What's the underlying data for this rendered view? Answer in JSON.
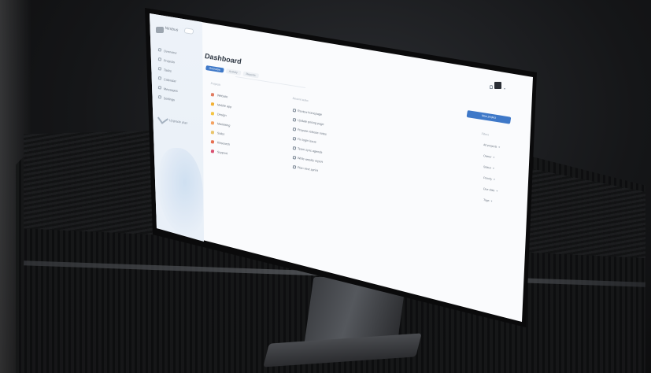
{
  "app": {
    "logo_text": "Nimbus",
    "page_title": "Dashboard",
    "tabs": [
      {
        "label": "Overview"
      },
      {
        "label": "Activity"
      },
      {
        "label": "Reports"
      }
    ],
    "search_placeholder": ""
  },
  "sidebar": {
    "items": [
      {
        "label": "Overview"
      },
      {
        "label": "Projects"
      },
      {
        "label": "Tasks"
      },
      {
        "label": "Calendar"
      },
      {
        "label": "Messages"
      },
      {
        "label": "Settings"
      }
    ],
    "promo_text": "Upgrade plan"
  },
  "main": {
    "left_header": "Projects",
    "left_rows": [
      {
        "label": "Website",
        "color": "#e07a5f"
      },
      {
        "label": "Mobile app",
        "color": "#f2b134"
      },
      {
        "label": "Design",
        "color": "#f4c542"
      },
      {
        "label": "Marketing",
        "color": "#f4a261"
      },
      {
        "label": "Sales",
        "color": "#e9c46a"
      },
      {
        "label": "Research",
        "color": "#e76f51"
      },
      {
        "label": "Support",
        "color": "#d94f70"
      }
    ],
    "mid_header": "Recent tasks",
    "mid_rows": [
      {
        "label": "Review homepage"
      },
      {
        "label": "Update pricing page"
      },
      {
        "label": "Prepare release notes"
      },
      {
        "label": "Fix login issue"
      },
      {
        "label": "Team sync agenda"
      },
      {
        "label": "Write weekly report"
      },
      {
        "label": "Plan next sprint"
      }
    ],
    "primary_button": "New project",
    "right_header": "Filters",
    "right_rows": [
      {
        "label": "All projects"
      },
      {
        "label": "Owner"
      },
      {
        "label": "Status"
      },
      {
        "label": "Priority"
      },
      {
        "label": "Due date"
      },
      {
        "label": "Tags"
      }
    ]
  },
  "colors": {
    "accent": "#3e78c8",
    "sidebar_bg": "#e6eef7",
    "screen_bg": "#fafbfd",
    "bezel": "#0a0a0b"
  }
}
